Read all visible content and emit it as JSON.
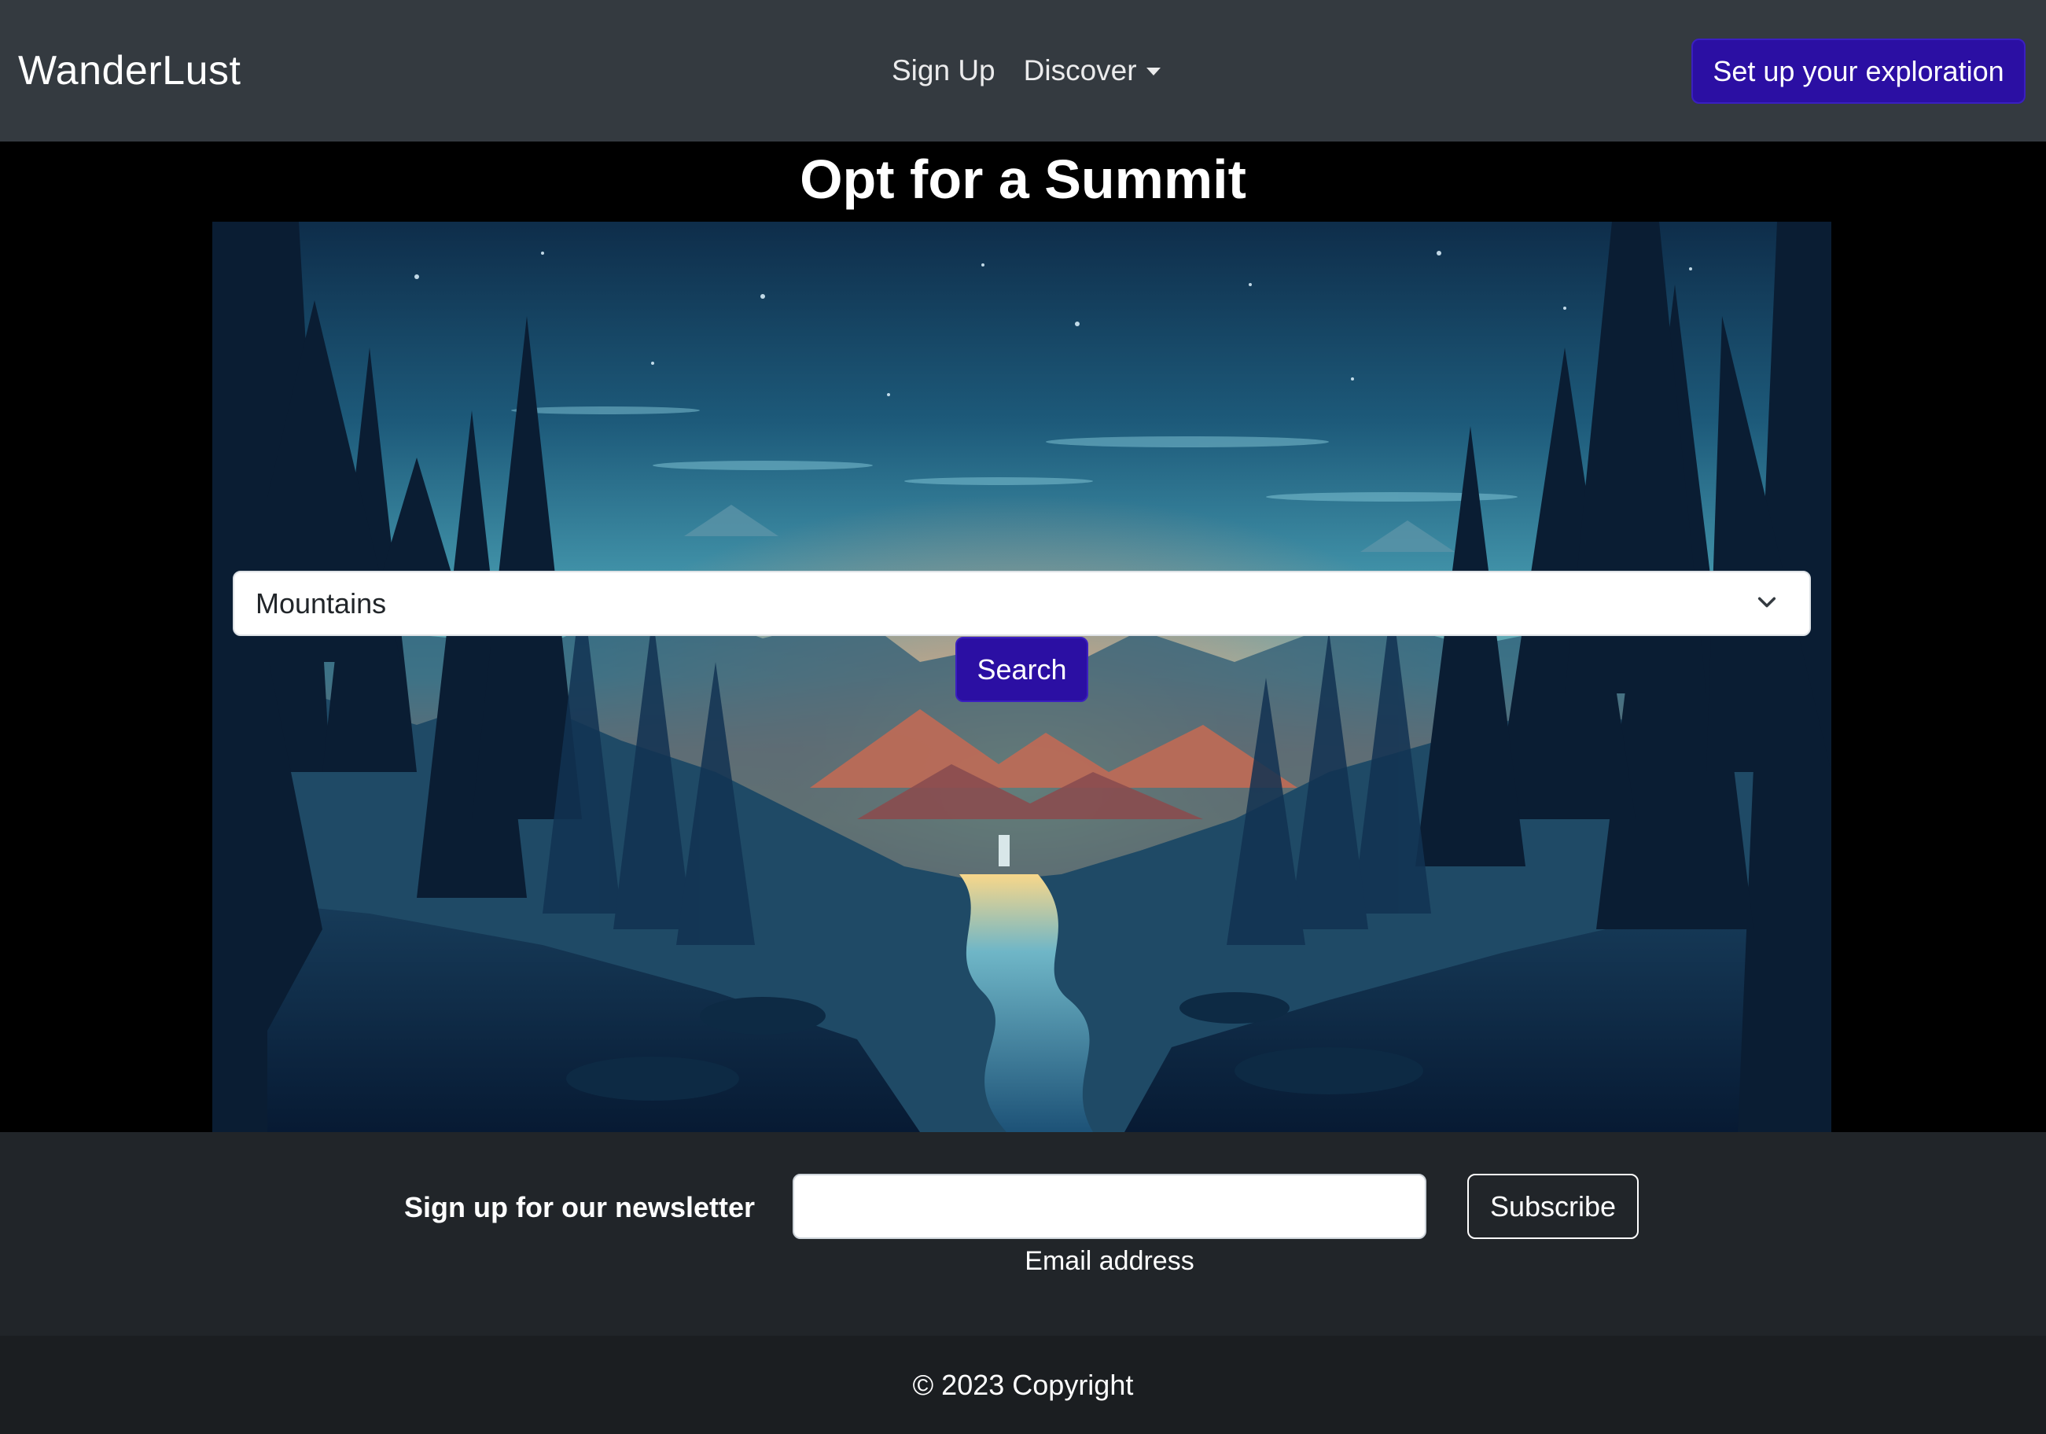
{
  "navbar": {
    "brand": "WanderLust",
    "links": [
      {
        "label": "Sign Up"
      },
      {
        "label": "Discover",
        "has_dropdown": true
      }
    ],
    "cta_label": "Set up your exploration"
  },
  "hero": {
    "title": "Opt for a Summit",
    "select": {
      "selected_value": "Mountains",
      "icon": "chevron-down-icon"
    },
    "search_label": "Search"
  },
  "newsletter": {
    "label": "Sign up for our newsletter",
    "email": {
      "value": "",
      "help_text": "Email address"
    },
    "subscribe_label": "Subscribe"
  },
  "footer": {
    "copyright": "© 2023 Copyright"
  },
  "colors": {
    "navbar_bg": "#343a40",
    "primary_button": "#2b0fa3",
    "newsletter_bg": "#212529",
    "footer_bg": "#1b1e21",
    "page_bg": "#000000"
  }
}
